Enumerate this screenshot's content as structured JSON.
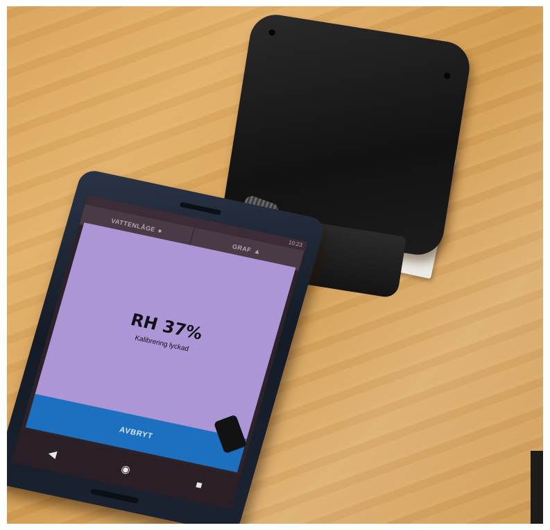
{
  "app": {
    "tabs": [
      {
        "label": "VATTENLÅGE",
        "icon": "water-drop-icon"
      },
      {
        "label": "GRAF",
        "icon": "chart-icon"
      }
    ],
    "status_bar": {
      "time": "10:23"
    },
    "dialog": {
      "value": "RH 37%",
      "status": "Kalibrering lyckad"
    },
    "cancel_label": "AVBRYT",
    "nav": {
      "back_icon": "back-triangle-icon",
      "home_icon": "home-circle-icon",
      "recents_icon": "recents-square-icon"
    }
  },
  "colors": {
    "dialog_background": "#ad96d6",
    "button_background": "#1d6fc0",
    "table_wood": "#d9a35a"
  }
}
